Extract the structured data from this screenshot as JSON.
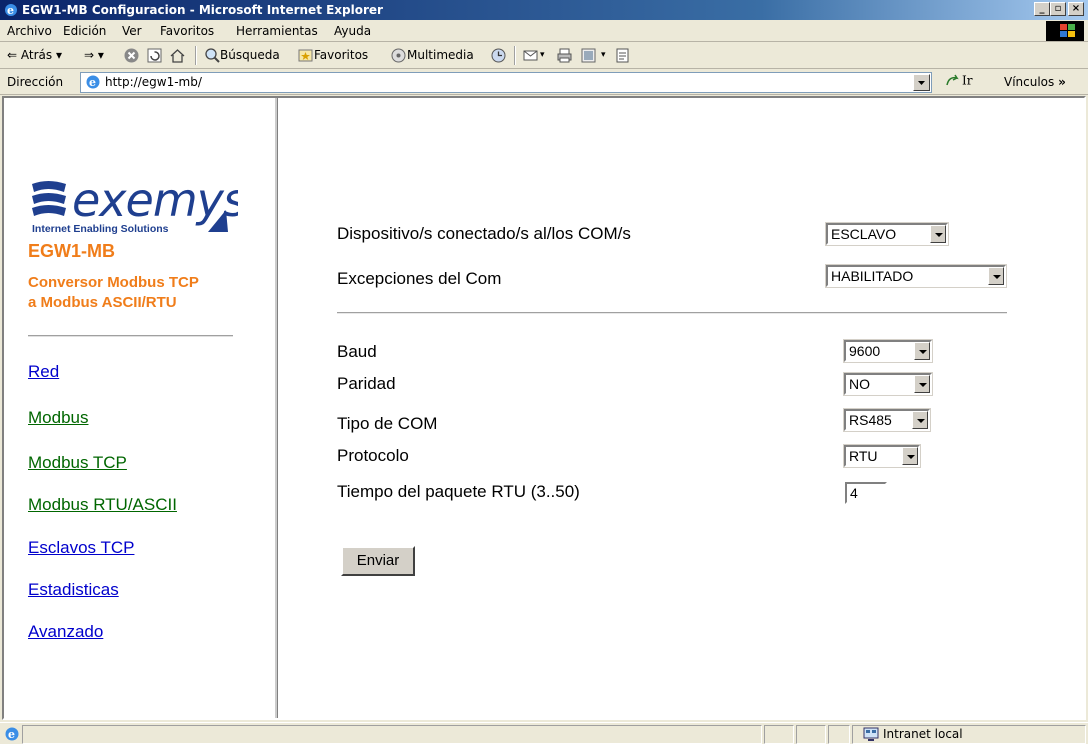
{
  "window": {
    "title": "EGW1-MB Configuracion - Microsoft Internet Explorer",
    "controls": {
      "minimize": "_",
      "maximize": "▫",
      "close": "×"
    }
  },
  "menu": [
    "Archivo",
    "Edición",
    "Ver",
    "Favoritos",
    "Herramientas",
    "Ayuda"
  ],
  "toolbar": {
    "back": "Atrás",
    "search": "Búsqueda",
    "favorites": "Favoritos",
    "multimedia": "Multimedia"
  },
  "address": {
    "label": "Dirección",
    "url": "http://egw1-mb/",
    "go": "Ir",
    "links": "Vínculos"
  },
  "sidebar": {
    "logo_text": "exemys",
    "logo_tagline": "Internet Enabling Solutions",
    "product_name": "EGW1-MB",
    "product_desc_line1": "Conversor Modbus TCP",
    "product_desc_line2": "a Modbus ASCII/RTU",
    "links": [
      {
        "label": "Red",
        "color": "#0000cc"
      },
      {
        "label": "Modbus",
        "color": "#006600"
      },
      {
        "label": "Modbus TCP",
        "color": "#006600"
      },
      {
        "label": "Modbus RTU/ASCII",
        "color": "#006600"
      },
      {
        "label": "Esclavos TCP",
        "color": "#0000cc"
      },
      {
        "label": "Estadisticas",
        "color": "#0000cc"
      },
      {
        "label": "Avanzado",
        "color": "#0000cc"
      }
    ]
  },
  "form": {
    "device_label": "Dispositivo/s conectado/s al/los COM/s",
    "device_value": "ESCLAVO",
    "exceptions_label": "Excepciones del Com",
    "exceptions_value": "HABILITADO",
    "baud_label": "Baud",
    "baud_value": "9600",
    "parity_label": "Paridad",
    "parity_value": "NO",
    "comtype_label": "Tipo de COM",
    "comtype_value": "RS485",
    "protocol_label": "Protocolo",
    "protocol_value": "RTU",
    "rtu_time_label": "Tiempo del paquete RTU (3..50)",
    "rtu_time_value": "4",
    "submit_label": "Enviar"
  },
  "status": {
    "zone": "Intranet local"
  },
  "colors": {
    "brand_orange": "#f07d1a",
    "brand_blue": "#1f3f8f",
    "titlebar": "#0a246a"
  }
}
